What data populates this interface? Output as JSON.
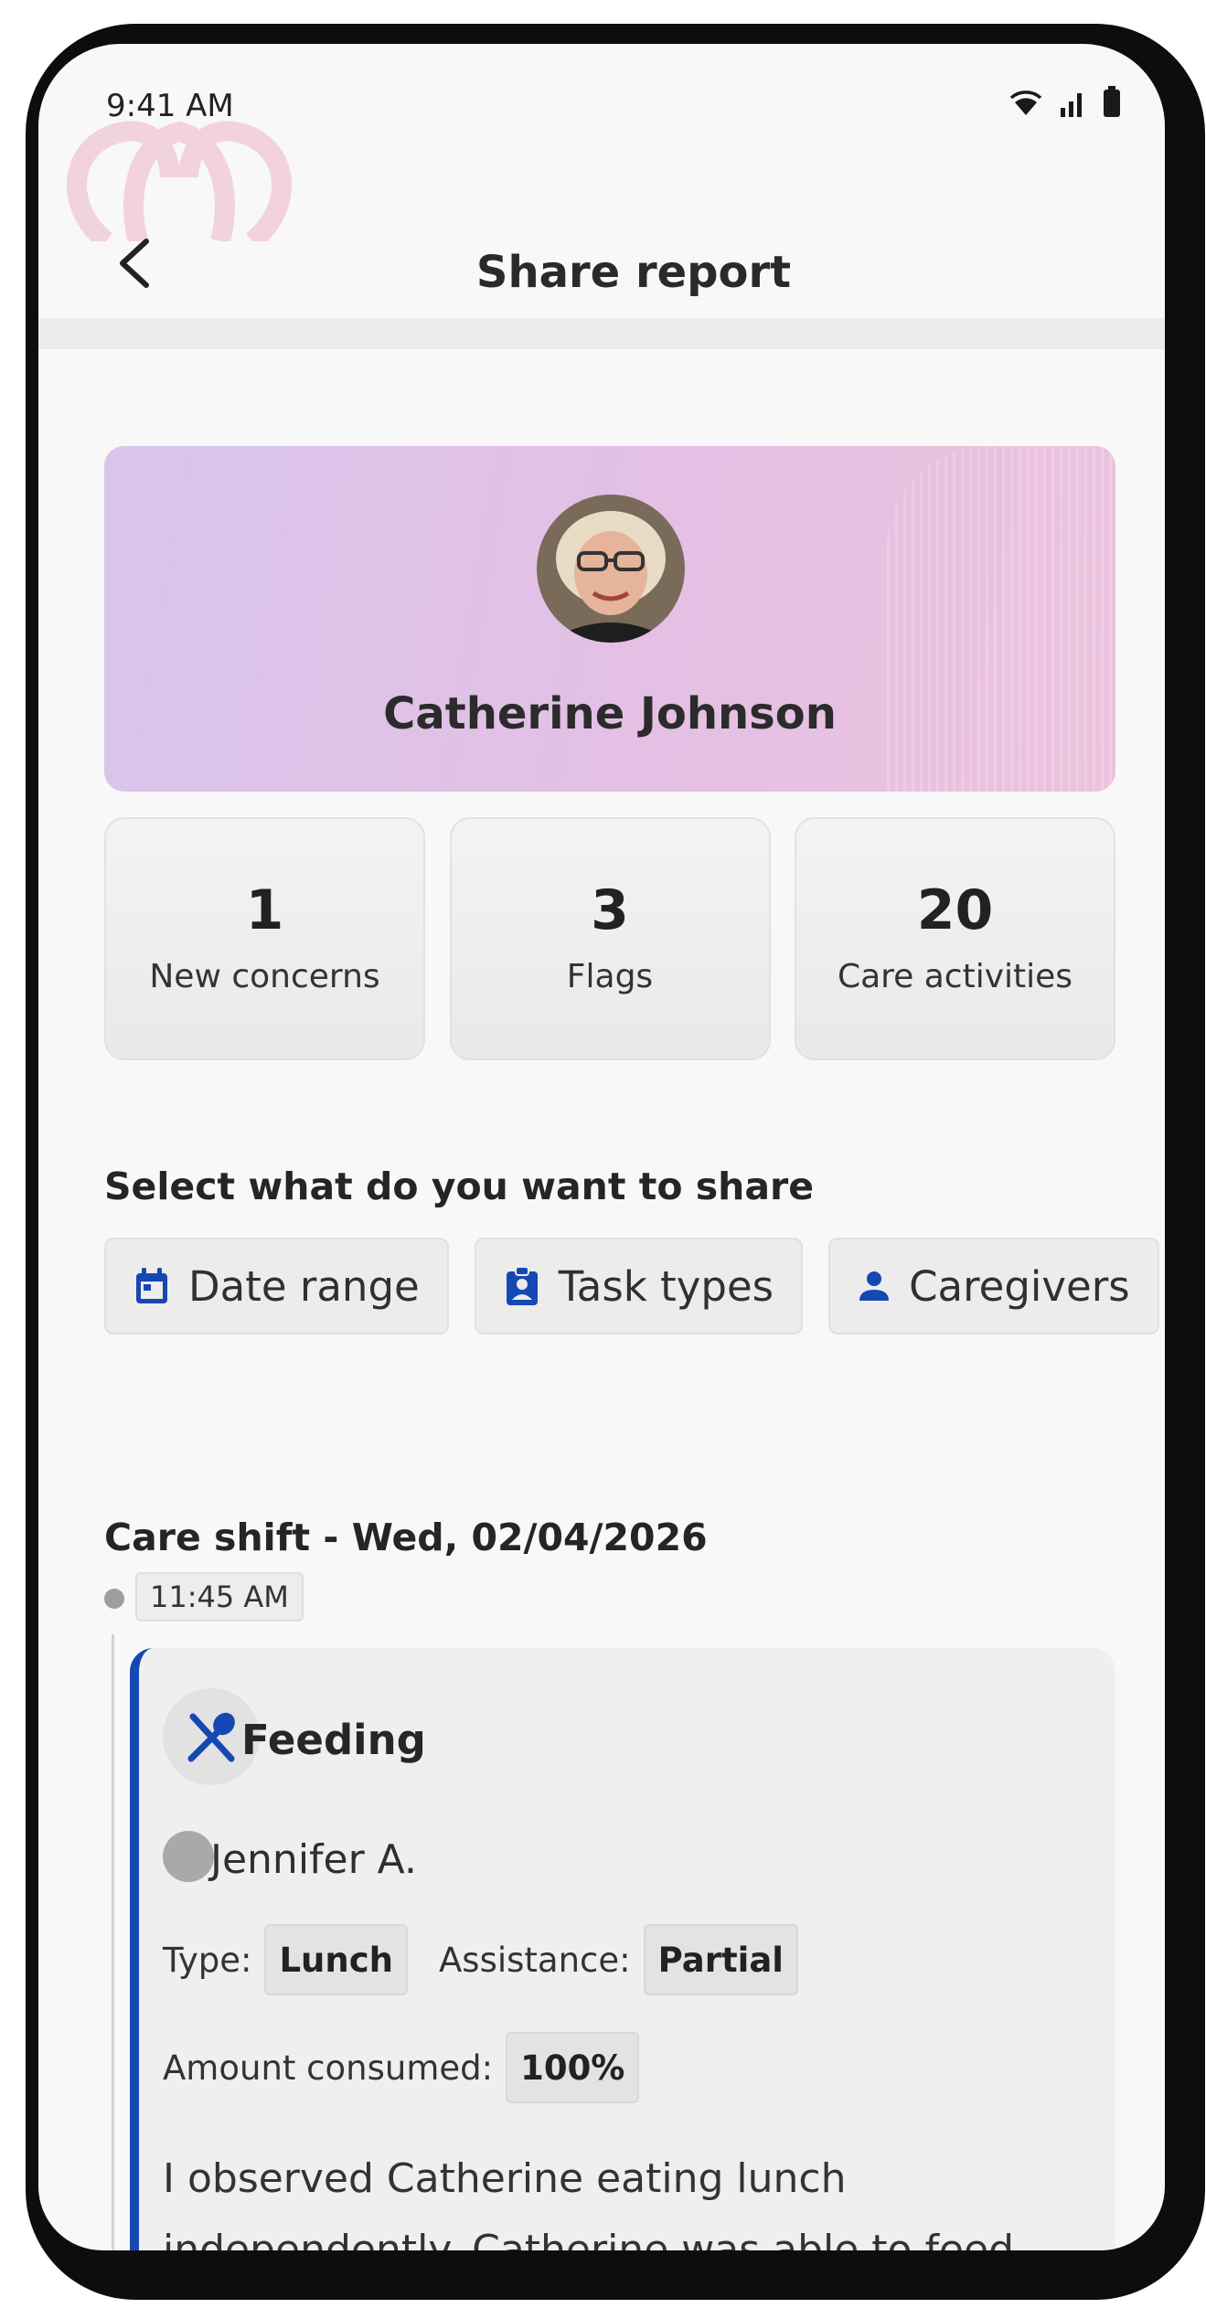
{
  "status_bar": {
    "time": "9:41 AM",
    "icons": [
      "wifi-icon",
      "signal-icon",
      "battery-icon"
    ]
  },
  "app_bar": {
    "title": "Share report",
    "back_icon": "chevron-left-icon"
  },
  "profile": {
    "name": "Catherine Johnson"
  },
  "stats": [
    {
      "value": "1",
      "label": "New concerns"
    },
    {
      "value": "3",
      "label": "Flags"
    },
    {
      "value": "20",
      "label": "Care activities"
    }
  ],
  "share_section": {
    "heading": "Select what do you want to share",
    "chips": [
      {
        "label": "Date range",
        "icon": "calendar-icon"
      },
      {
        "label": "Task types",
        "icon": "clipboard-icon"
      },
      {
        "label": "Caregivers",
        "icon": "person-icon"
      }
    ]
  },
  "shift": {
    "heading": "Care shift - Wed, 02/04/2026",
    "time": "11:45 AM",
    "activity": {
      "title": "Feeding",
      "icon": "utensils-icon",
      "caregiver": "Jennifer A.",
      "type_label": "Type:",
      "type_value": "Lunch",
      "assistance_label": "Assistance:",
      "assistance_value": "Partial",
      "amount_label": "Amount consumed:",
      "amount_value": "100%",
      "note": "I observed Catherine eating lunch independently. Catherine was able to feed"
    }
  },
  "colors": {
    "accent": "#1648b3",
    "card_gradient_start": "#d9c4ec",
    "card_gradient_end": "#ecc2dd"
  }
}
